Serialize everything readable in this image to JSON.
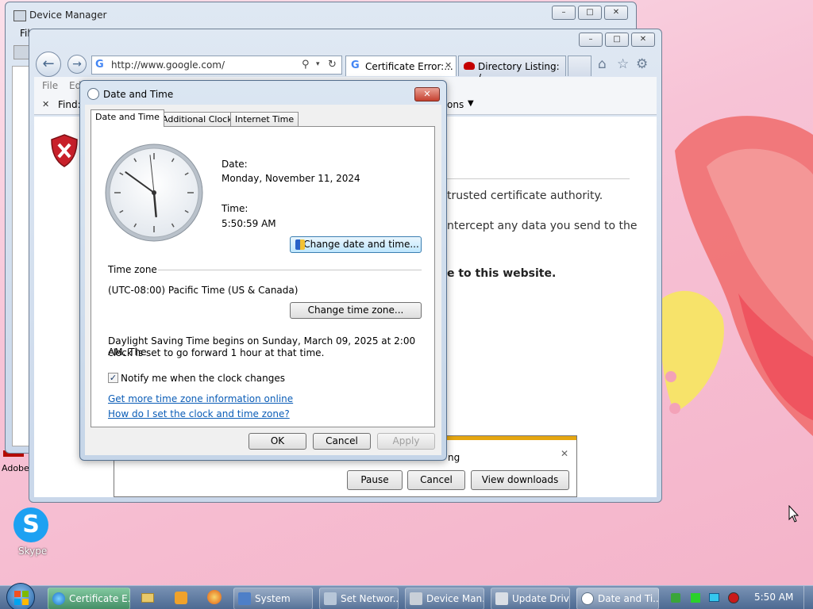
{
  "device_manager": {
    "title": "Device Manager",
    "menu_first": "Fil",
    "min": "–",
    "max": "□",
    "close": "✕"
  },
  "ie": {
    "address": "http://www.google.com/",
    "tabs": [
      {
        "label": "Certificate Error:..."
      },
      {
        "label": "Directory Listing: /..."
      }
    ],
    "menu_items": [
      "File",
      "Ed"
    ],
    "find_label": "Find:",
    "options_label": "ons",
    "page_text": {
      "line1": "trusted certificate authority.",
      "line2": "ntercept any data you send to the",
      "line3": "e to this website."
    }
  },
  "download_bar": {
    "text": "ng",
    "pause": "Pause",
    "cancel": "Cancel",
    "view": "View downloads",
    "close": "✕"
  },
  "dialog": {
    "title": "Date and Time",
    "close": "✕",
    "tabs": [
      "Date and Time",
      "Additional Clocks",
      "Internet Time"
    ],
    "date_label": "Date:",
    "date_value": "Monday, November 11, 2024",
    "time_label": "Time:",
    "time_value": "5:50:59 AM",
    "change_dt_btn": "Change date and time...",
    "tz_header": "Time zone",
    "tz_value": "(UTC-08:00) Pacific Time (US & Canada)",
    "change_tz_btn": "Change time zone...",
    "dst_line1": "Daylight Saving Time begins on Sunday, March 09, 2025 at 2:00 AM. The",
    "dst_line2": "clock is set to go forward 1 hour at that time.",
    "notify_label": "Notify me when the clock changes",
    "notify_checked": true,
    "link1": "Get more time zone information online",
    "link2": "How do I set the clock and time zone?",
    "ok": "OK",
    "cancel": "Cancel",
    "apply": "Apply",
    "clock": {
      "hour": 5,
      "minute": 50,
      "second": 59
    }
  },
  "desktop": {
    "adobe_label": "Adobe",
    "skype_label": "Skype"
  },
  "taskbar": {
    "items": [
      {
        "label": "Certificate E...",
        "icon": "ie-icon"
      },
      {
        "label": "System",
        "icon": "system-icon"
      },
      {
        "label": "Set Networ...",
        "icon": "network-icon"
      },
      {
        "label": "Device Man...",
        "icon": "device-manager-icon"
      },
      {
        "label": "Update Driv...",
        "icon": "update-driver-icon"
      },
      {
        "label": "Date and Ti...",
        "icon": "clock-icon"
      }
    ],
    "clock": "5:50 AM"
  }
}
